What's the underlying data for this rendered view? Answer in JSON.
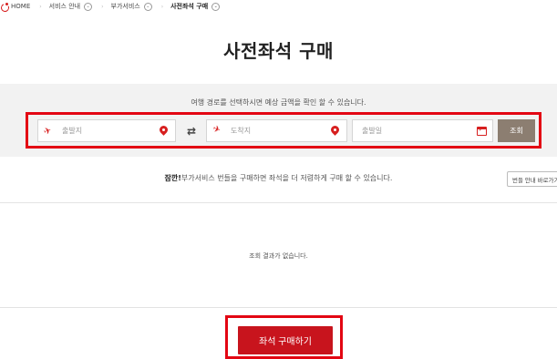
{
  "breadcrumb": {
    "home": "HOME",
    "items": [
      "서비스 안내",
      "부가서비스",
      "사전좌석 구매"
    ]
  },
  "page_title": "사전좌석 구매",
  "search": {
    "guide": "여행 경로를 선택하시면 예상 금액을 확인 할 수 있습니다.",
    "departure_placeholder": "출발지",
    "arrival_placeholder": "도착지",
    "date_placeholder": "출발일",
    "search_button": "조회"
  },
  "notice": {
    "highlight": "잠깐!",
    "text": "부가서비스 번들을 구매하면 좌석을 더 저렴하게 구매 할 수 있습니다.",
    "bundle_button": "번들 안내 바로가기"
  },
  "results": {
    "empty_message": "조회 결과가 없습니다."
  },
  "cta": {
    "label": "좌석 구매하기"
  },
  "colors": {
    "accent": "#d71f1f",
    "highlight_border": "#e30613",
    "search_button": "#8c7e71",
    "cta": "#c8141d"
  }
}
